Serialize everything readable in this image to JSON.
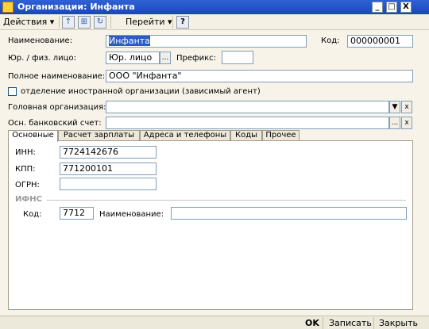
{
  "window": {
    "title": "Организации: Инфанта",
    "btn_min": "_",
    "btn_max": "□",
    "btn_close": "X"
  },
  "toolbar": {
    "actions_label": "Действия",
    "goto_label": "Перейти",
    "help_label": "?",
    "caret": "▾"
  },
  "form": {
    "name_label": "Наименование:",
    "name_value": "Инфанта",
    "code_label": "Код:",
    "code_value": "000000001",
    "entity_label": "Юр. / физ. лицо:",
    "entity_value": "Юр. лицо",
    "prefix_label": "Префикс:",
    "prefix_value": "",
    "fullname_label": "Полное наименование:",
    "fullname_value": "ООО \"Инфанта\"",
    "foreign_label": "отделение иностранной организации (зависимый агент)",
    "foreign_checked": false,
    "parent_label": "Головная организация:",
    "parent_value": "",
    "bank_label": "Осн. банковский счет:",
    "bank_value": "",
    "ellipsis": "...",
    "clear": "x",
    "drop": "▼"
  },
  "tabs": [
    "Основные",
    "Расчет зарплаты",
    "Адреса и телефоны",
    "Коды",
    "Прочее"
  ],
  "main": {
    "inn_label": "ИНН:",
    "inn_value": "7724142676",
    "kpp_label": "КПП:",
    "kpp_value": "771200101",
    "ogrn_label": "ОГРН:",
    "ogrn_value": "",
    "ifns_header": "ИФНС",
    "ifns_code_label": "Код:",
    "ifns_code_value": "7712",
    "ifns_name_label": "Наименование:",
    "ifns_name_value": ""
  },
  "status": {
    "ok": "OK",
    "save": "Записать",
    "close": "Закрыть"
  }
}
